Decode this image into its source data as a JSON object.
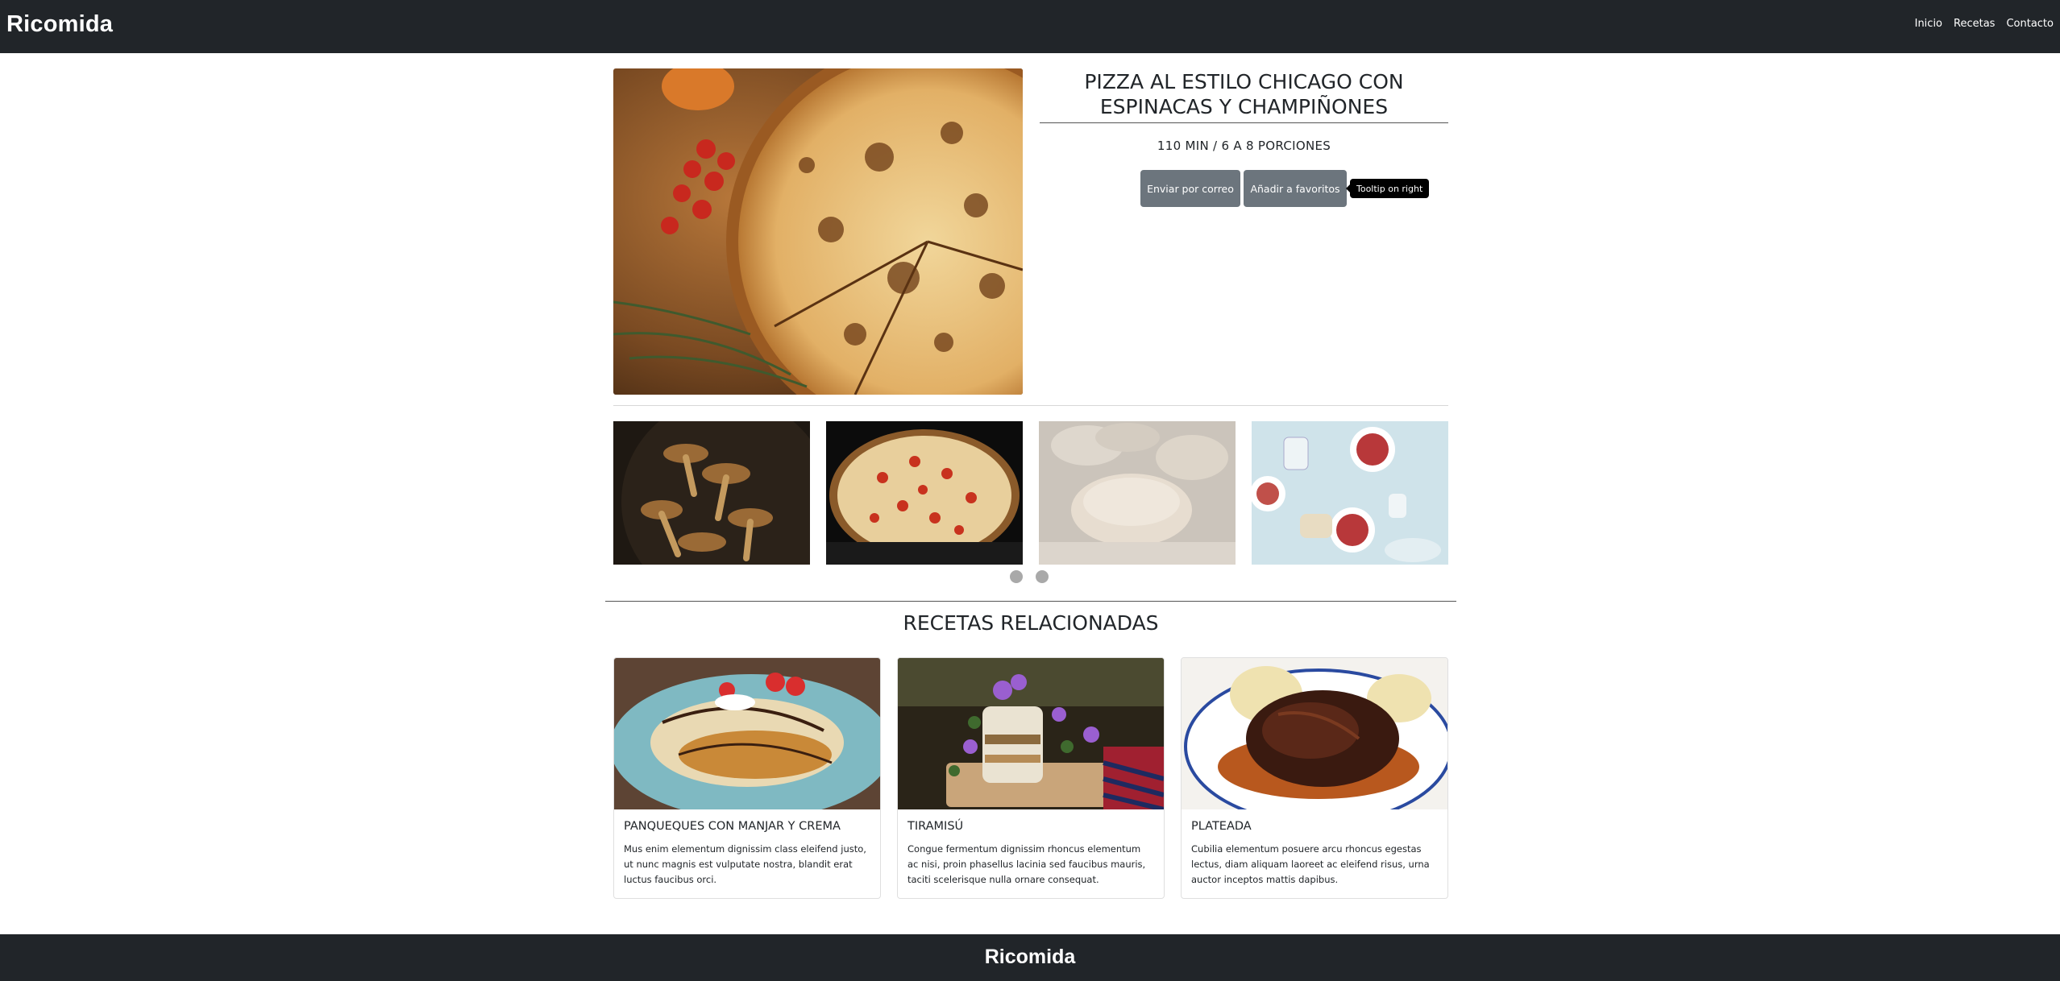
{
  "navbar": {
    "brand": "Ricomida",
    "links": [
      "Inicio",
      "Recetas",
      "Contacto"
    ]
  },
  "recipe": {
    "title": "PIZZA AL ESTILO CHICAGO CON ESPINACAS Y CHAMPIÑONES",
    "meta": "110 MIN / 6 A 8 PORCIONES",
    "email_button": "Enviar por correo",
    "favorite_button": "Añadir a favoritos",
    "tooltip": "Tooltip on right"
  },
  "related": {
    "title": "RECETAS RELACIONADAS",
    "cards": [
      {
        "title": "PANQUEQUES CON MANJAR Y CREMA",
        "text": "Mus enim elementum dignissim class eleifend justo, ut nunc magnis est vulputate nostra, blandit erat luctus faucibus orci."
      },
      {
        "title": "TIRAMISÚ",
        "text": "Congue fermentum dignissim rhoncus elementum ac nisi, proin phasellus lacinia sed faucibus mauris, taciti scelerisque nulla ornare consequat."
      },
      {
        "title": "PLATEADA",
        "text": "Cubilia elementum posuere arcu rhoncus egestas lectus, diam aliquam laoreet ac eleifend risus, urna auctor inceptos mattis dapibus."
      }
    ]
  },
  "footer": {
    "brand": "Ricomida"
  }
}
